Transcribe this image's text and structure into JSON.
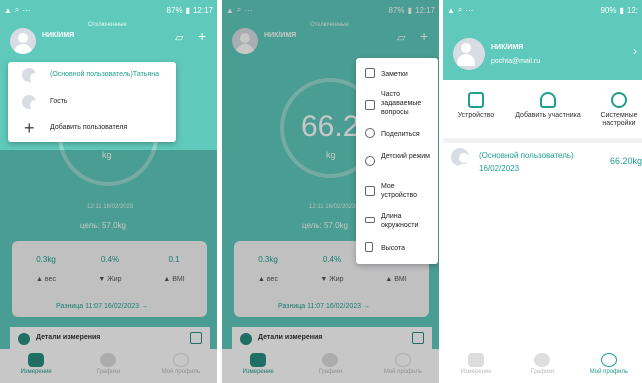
{
  "status": {
    "p1_battery": "87%",
    "p1_time": "12:17",
    "p2_battery": "87%",
    "p2_time": "12:17",
    "p3_battery": "90%",
    "p3_time": "12:"
  },
  "header": {
    "username": "НИК/ИМЯ",
    "connection": "Отключенные"
  },
  "gauge": {
    "value_p2": "66.20",
    "unit": "kg",
    "datetime": "12:11 16/02/2023",
    "goal": "цель: 57.0kg"
  },
  "stats": [
    {
      "value": "0.3kg",
      "label": "вес",
      "arrow": "▲"
    },
    {
      "value": "0.4%",
      "label": "Жир",
      "arrow": "▼"
    },
    {
      "value": "0.1",
      "label": "BMI",
      "arrow": "▲"
    }
  ],
  "diff": "Разница 11:07 16/02/2023 →",
  "details": "Детали измерения",
  "bottom_nav": [
    {
      "label": "Измерение",
      "active": true
    },
    {
      "label": "Графики",
      "active": false
    },
    {
      "label": "Мой профиль",
      "active": false
    }
  ],
  "bottom_nav_p3": [
    {
      "label": "Измерение",
      "active": false
    },
    {
      "label": "Графики",
      "active": false
    },
    {
      "label": "Мой профиль",
      "active": true
    }
  ],
  "user_dropdown": [
    {
      "label": "(Основной пользователь)Татьяна",
      "icon": "avatar-icon"
    },
    {
      "label": "Гость",
      "icon": "avatar-icon"
    },
    {
      "label": "Добавить пользователя",
      "icon": "plus-icon"
    }
  ],
  "more_menu": [
    {
      "label": "Заметки",
      "icon": "notes-icon"
    },
    {
      "label": "Часто задаваемые вопросы",
      "icon": "faq-icon"
    },
    {
      "label": "Поделиться",
      "icon": "share-icon"
    },
    {
      "label": "Детский режим",
      "icon": "child-icon"
    },
    {
      "label": "Мое устройство",
      "icon": "device-icon"
    },
    {
      "label": "Длина окружности",
      "icon": "tape-icon"
    },
    {
      "label": "Высота",
      "icon": "height-icon"
    }
  ],
  "profile": {
    "name": "НИК/ИМЯ",
    "email": "pochta@mail.ru",
    "actions": [
      {
        "label": "Устройство",
        "icon": "device-icon"
      },
      {
        "label": "Добавить участника",
        "icon": "add-member-icon"
      },
      {
        "label": "Системные настройки",
        "icon": "gear-icon"
      }
    ],
    "user_name": "(Основной пользователь)",
    "user_date": "16/02/2023",
    "user_weight": "66.20kg"
  },
  "colors": {
    "teal": "#5fc9bb",
    "accent": "#1fa08f"
  }
}
